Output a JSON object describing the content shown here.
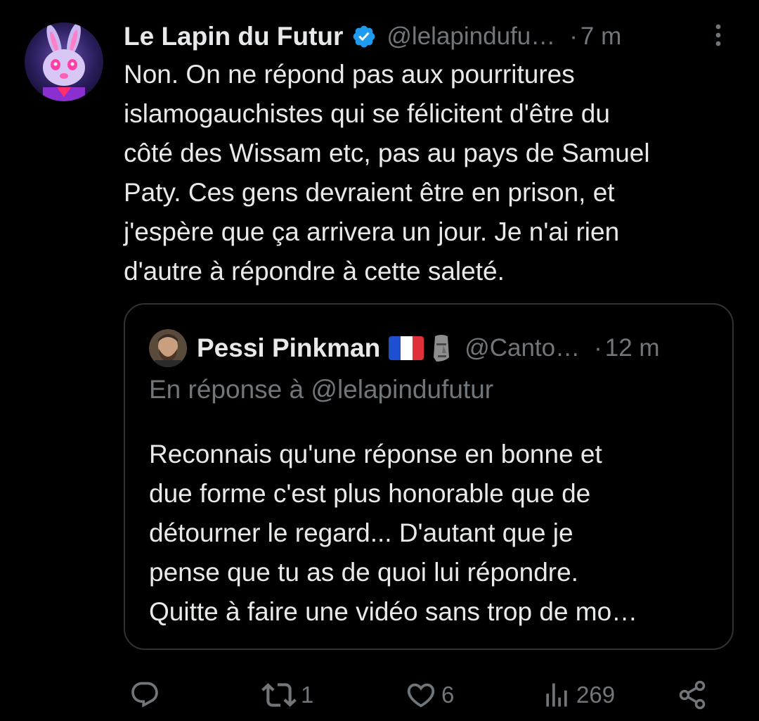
{
  "author": {
    "name": "Le Lapin du Futur",
    "handle": "@lelapindufu…",
    "dot": "·",
    "time": "7 m",
    "verified": true
  },
  "tweet_text": "Non. On ne répond pas aux pourritures\nislamogauchistes qui se félicitent d'être du\ncôté des Wissam etc, pas au pays de Samuel\nPaty. Ces gens devraient être en prison, et\nj'espère que ça arrivera un jour. Je n'ai rien\nd'autre à répondre à cette saleté.",
  "quoted": {
    "name": "Pessi Pinkman",
    "handle": "@Canto…",
    "dot": "·",
    "time": "12 m",
    "reply_to": "En réponse à @lelapindufutur",
    "text": "Reconnais qu'une réponse en bonne et\ndue forme c'est plus honorable que de\ndétourner le regard... D'autant que je\npense que tu as de quoi lui répondre.\nQuitte à faire une vidéo sans trop de mo…"
  },
  "actions": {
    "reply": {
      "icon": "reply-icon",
      "count": ""
    },
    "retweet": {
      "icon": "retweet-icon",
      "count": "1"
    },
    "like": {
      "icon": "heart-icon",
      "count": "6"
    },
    "views": {
      "icon": "views-icon",
      "count": "269"
    },
    "share": {
      "icon": "share-icon"
    }
  },
  "colors": {
    "background": "#000000",
    "text": "#e7e9ea",
    "muted": "#71767b",
    "border": "#2f3336",
    "verified": "#1d9bf0"
  }
}
